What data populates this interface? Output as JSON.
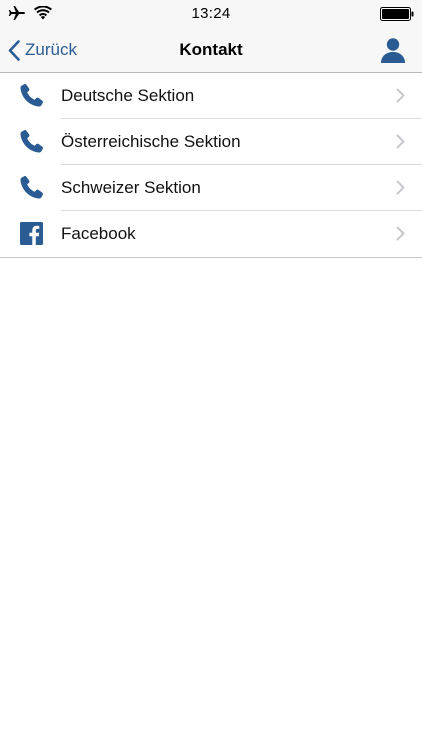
{
  "status_bar": {
    "time": "13:24",
    "icons": [
      "airplane-icon",
      "wifi-icon",
      "battery-icon"
    ]
  },
  "nav": {
    "back_label": "Zurück",
    "title": "Kontakt",
    "right_icon": "user-icon"
  },
  "colors": {
    "accent": "#2a5c93",
    "chevron": "#c7c7cc",
    "bar_background": "#f7f7f7"
  },
  "list": {
    "items": [
      {
        "label": "Deutsche Sektion",
        "icon": "phone-icon"
      },
      {
        "label": "Österreichische Sektion",
        "icon": "phone-icon"
      },
      {
        "label": "Schweizer Sektion",
        "icon": "phone-icon"
      },
      {
        "label": "Facebook",
        "icon": "facebook-icon"
      }
    ]
  }
}
